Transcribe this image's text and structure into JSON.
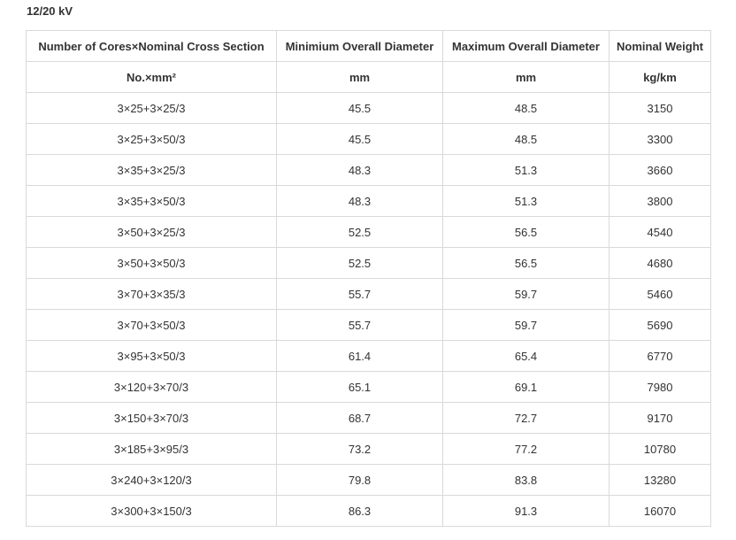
{
  "caption": "12/20 kV",
  "table": {
    "headers": [
      "Number of Cores×Nominal Cross Section",
      "Minimium Overall Diameter",
      "Maximum Overall Diameter",
      "Nominal Weight"
    ],
    "units": [
      "No.×mm²",
      "mm",
      "mm",
      "kg/km"
    ],
    "rows": [
      [
        "3×25+3×25/3",
        "45.5",
        "48.5",
        "3150"
      ],
      [
        "3×25+3×50/3",
        "45.5",
        "48.5",
        "3300"
      ],
      [
        "3×35+3×25/3",
        "48.3",
        "51.3",
        "3660"
      ],
      [
        "3×35+3×50/3",
        "48.3",
        "51.3",
        "3800"
      ],
      [
        "3×50+3×25/3",
        "52.5",
        "56.5",
        "4540"
      ],
      [
        "3×50+3×50/3",
        "52.5",
        "56.5",
        "4680"
      ],
      [
        "3×70+3×35/3",
        "55.7",
        "59.7",
        "5460"
      ],
      [
        "3×70+3×50/3",
        "55.7",
        "59.7",
        "5690"
      ],
      [
        "3×95+3×50/3",
        "61.4",
        "65.4",
        "6770"
      ],
      [
        "3×120+3×70/3",
        "65.1",
        "69.1",
        "7980"
      ],
      [
        "3×150+3×70/3",
        "68.7",
        "72.7",
        "9170"
      ],
      [
        "3×185+3×95/3",
        "73.2",
        "77.2",
        "10780"
      ],
      [
        "3×240+3×120/3",
        "79.8",
        "83.8",
        "13280"
      ],
      [
        "3×300+3×150/3",
        "86.3",
        "91.3",
        "16070"
      ]
    ]
  }
}
